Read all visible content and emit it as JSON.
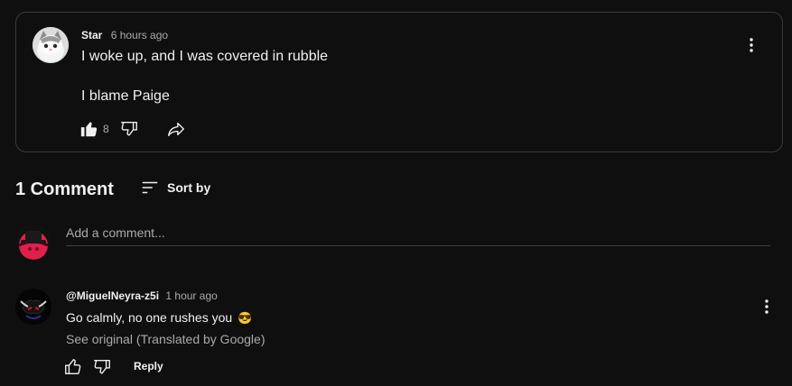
{
  "post": {
    "author": "Star",
    "time": "6 hours ago",
    "line1": "I woke up, and I was covered in rubble",
    "line2": "I blame Paige",
    "like_count": "8"
  },
  "comments_header": {
    "title": "1 Comment",
    "sort_label": "Sort by"
  },
  "add_comment": {
    "placeholder": "Add a comment..."
  },
  "comments": [
    {
      "author": "@MiguelNeyra-z5i",
      "time": "1 hour ago",
      "text": "Go calmly, no one rushes you",
      "emoji": "😎",
      "translate_label": "See original (Translated by Google)",
      "reply_label": "Reply"
    }
  ],
  "icons": {
    "post_like": "thumbs-up-filled-icon",
    "post_dislike": "thumbs-down-icon",
    "post_share": "share-icon",
    "post_menu": "more-vert-icon",
    "sort": "sort-icon",
    "comment_like": "thumbs-up-icon",
    "comment_dislike": "thumbs-down-icon",
    "comment_menu": "more-vert-icon"
  },
  "colors": {
    "background": "#0f0f0f",
    "text_primary": "#f1f1f1",
    "text_secondary": "#aaaaaa",
    "border": "#3a3a3a"
  }
}
